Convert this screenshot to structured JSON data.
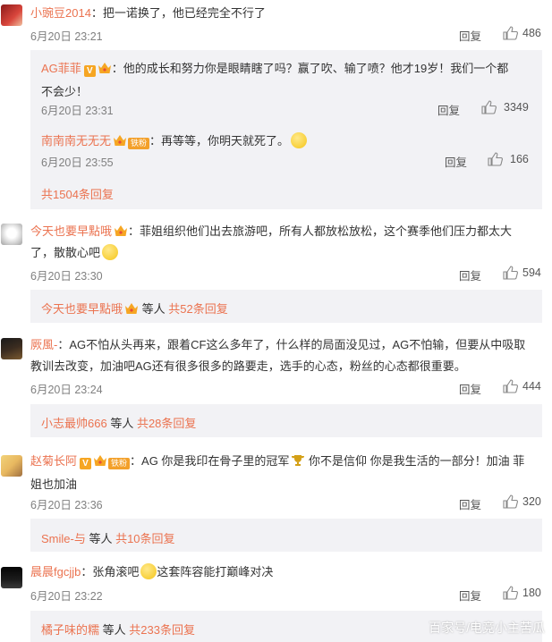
{
  "comments": [
    {
      "user": "小豌豆2014",
      "text": "：把一诺换了，他已经完全不行了",
      "date": "6月20日 23:21",
      "reply_label": "回复",
      "likes": "486",
      "replies": [
        {
          "user": "AG菲菲",
          "text_line1": "：他的成长和努力你是眼睛瞎了吗？赢了吹、输了喷？他才19岁！我们一个都",
          "text_line2": "不会少！",
          "date": "6月20日 23:31",
          "likes": "3349"
        },
        {
          "user": "南南南无无无",
          "fan_badge": "铁粉",
          "text": "：再等等，你明天就死了。",
          "date": "6月20日 23:55",
          "likes": "166"
        }
      ],
      "more": "共1504条回复"
    },
    {
      "user": "今天也要早點哦",
      "text_line1": "：菲姐组织他们出去旅游吧，所有人都放松放松，这个赛季他们压力都太大",
      "text_line2": "了，散散心吧",
      "date": "6月20日 23:30",
      "likes": "594",
      "more_user": "今天也要早點哦",
      "more_mid": " 等人 ",
      "more_count": "共52条回复"
    },
    {
      "user": "厥風-",
      "text_line1": "：AG不怕从头再来，跟着CF这么多年了，什么样的局面没见过，AG不怕输，但要从中吸取",
      "text_line2": "教训去改变，加油吧AG还有很多很多的路要走，选手的心态，粉丝的心态都很重要。",
      "date": "6月20日 23:24",
      "likes": "444",
      "more_user": "小志最帅666",
      "more_mid": " 等人 ",
      "more_count": "共28条回复"
    },
    {
      "user": "赵菊长阿",
      "fan_badge": "铁粉",
      "text_line1": "：AG 你是我印在骨子里的冠军",
      "text_line1b": " 你不是信仰 你是我生活的一部分！加油 菲",
      "text_line2": "姐也加油",
      "date": "6月20日 23:36",
      "likes": "320",
      "more_user": "Smile-与",
      "more_mid": " 等人 ",
      "more_count": "共10条回复"
    },
    {
      "user": "晨晨fgcjjb",
      "text_a": "：张角滚吧",
      "text_b": "这套阵容能打巅峰对决",
      "date": "6月20日 23:22",
      "likes": "180",
      "more_user": "橘子味的糯",
      "more_mid": " 等人 ",
      "more_count": "共233条回复"
    }
  ],
  "reply_label": "回复",
  "watermark": "百家号/电竞小主苦瓜",
  "colors": {
    "name": "#eb7350",
    "sub_bg": "#f2f2f5",
    "text": "#333333",
    "meta": "#808080"
  }
}
